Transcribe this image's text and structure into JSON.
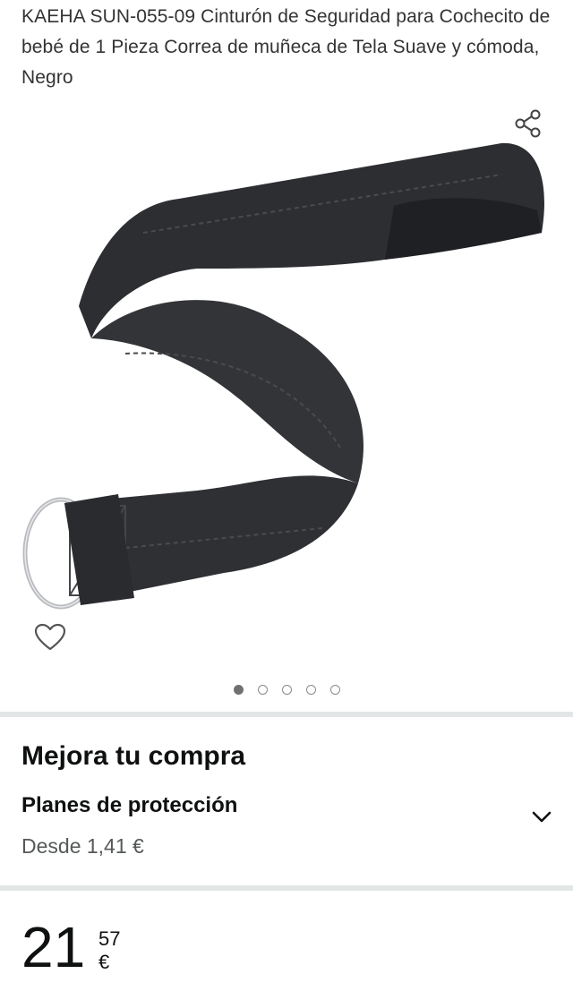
{
  "product": {
    "title": "KAEHA SUN-055-09 Cinturón de Seguridad para Cochecito de bebé de 1 Pieza Correa de muñeca de Tela Suave y cómoda, Negro",
    "image_alt": "Correa de muñeca de tela negra con anilla metálica"
  },
  "icons": {
    "share": "share-icon",
    "wishlist": "heart-outline-icon",
    "expand": "chevron-down-icon"
  },
  "carousel": {
    "count": 5,
    "active_index": 0
  },
  "upsell": {
    "heading": "Mejora tu compra",
    "plan_title": "Planes de protección",
    "plan_price": "Desde 1,41 €"
  },
  "price": {
    "whole": "21",
    "fraction": "57 €"
  },
  "colors": {
    "divider": "#e3e6e6",
    "text_primary": "#0f1111",
    "text_secondary": "#565959",
    "strap": "#2f3033"
  }
}
